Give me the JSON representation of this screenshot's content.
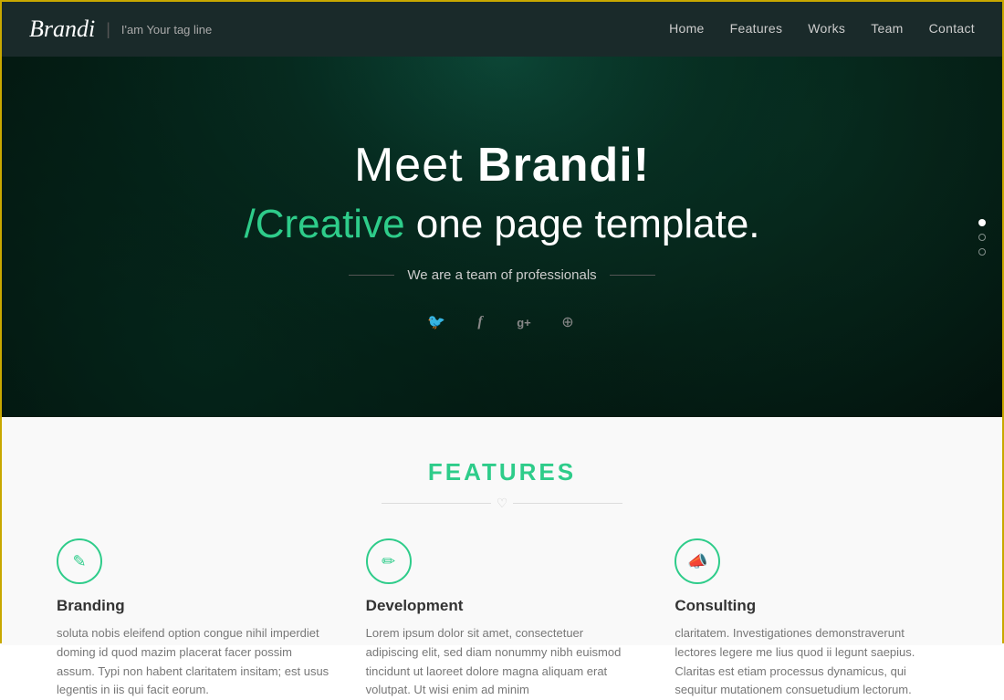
{
  "navbar": {
    "brand_name": "Brandi",
    "separator": "|",
    "tagline": "I'am Your tag line",
    "nav_items": [
      {
        "label": "Home",
        "href": "#home"
      },
      {
        "label": "Features",
        "href": "#features"
      },
      {
        "label": "Works",
        "href": "#works"
      },
      {
        "label": "Team",
        "href": "#team"
      },
      {
        "label": "Contact",
        "href": "#contact"
      }
    ]
  },
  "hero": {
    "title_prefix": "Meet ",
    "title_bold": "Brandi!",
    "subtitle_accent": "/Creative",
    "subtitle_rest": " one page template.",
    "tagline": "We are a team of professionals",
    "social": [
      {
        "name": "twitter",
        "icon": "𝕋",
        "unicode": "🐦"
      },
      {
        "name": "facebook",
        "icon": "f"
      },
      {
        "name": "google-plus",
        "icon": "g+"
      },
      {
        "name": "web",
        "icon": "⊕"
      }
    ],
    "slides": [
      {
        "active": true
      },
      {
        "active": false
      },
      {
        "active": false
      }
    ]
  },
  "features_section": {
    "title": "FEATURES",
    "heart": "♡",
    "cards": [
      {
        "icon": "✎",
        "title": "Branding",
        "text": "soluta nobis eleifend option congue nihil imperdiet doming id quod mazim placerat facer possim assum. Typi non habent claritatem insitam; est usus legentis in iis qui facit eorum."
      },
      {
        "icon": "✏",
        "title": "Development",
        "text": "Lorem ipsum dolor sit amet, consectetuer adipiscing elit, sed diam nonummy nibh euismod tincidunt ut laoreet dolore magna aliquam erat volutpat. Ut wisi enim ad minim"
      },
      {
        "icon": "📣",
        "title": "Consulting",
        "text": "claritatem. Investigationes demonstraverunt lectores legere me lius quod ii legunt saepius. Claritas est etiam processus dynamicus, qui sequitur mutationem consuetudium lectorum."
      }
    ]
  }
}
